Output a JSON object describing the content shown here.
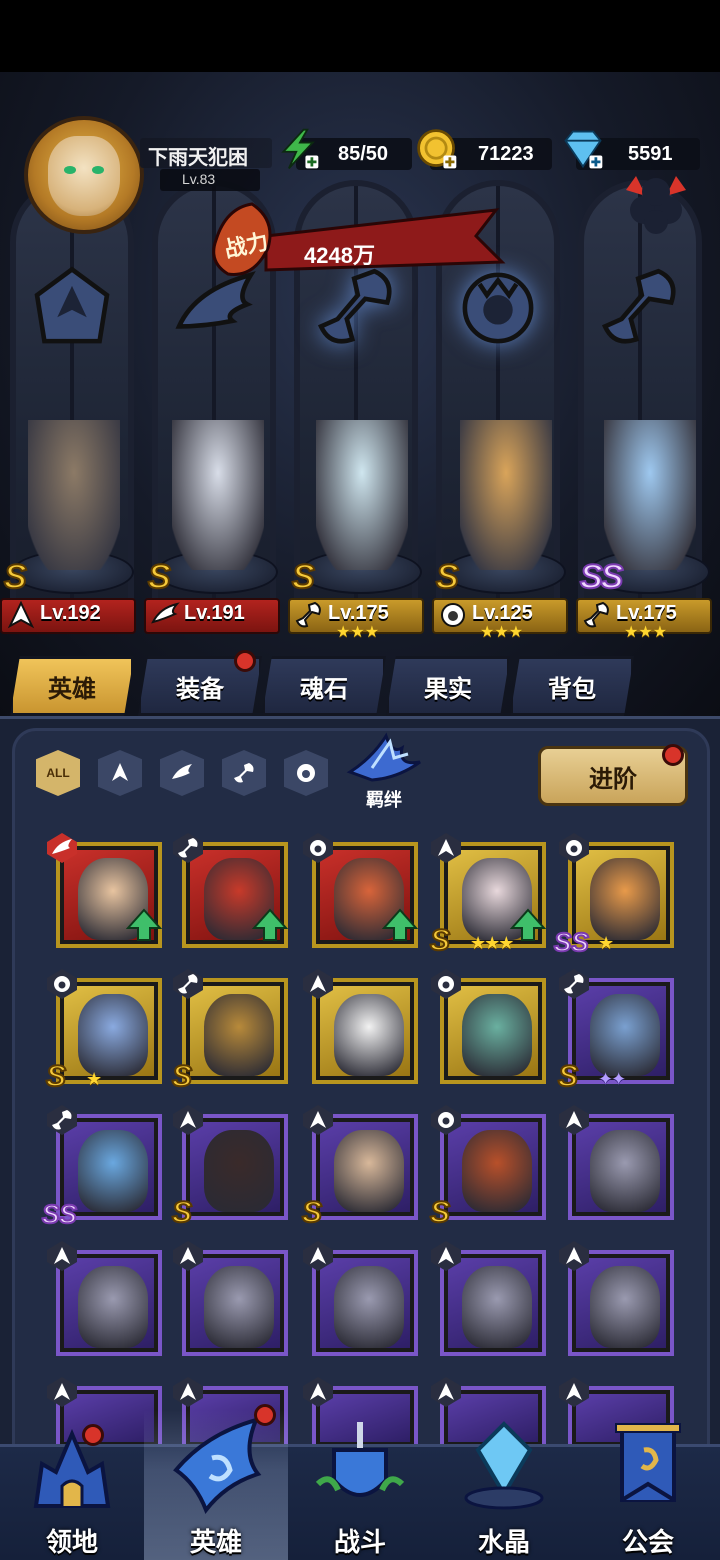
{
  "player": {
    "name": "下雨天犯困",
    "level": "Lv.83"
  },
  "resources": {
    "stamina": "85/50",
    "gold": "71223",
    "gems": "5591"
  },
  "power": {
    "label": "战力",
    "value": "4248万"
  },
  "team": [
    {
      "level": "Lv.192",
      "rank": "S",
      "class": "warrior",
      "stars": "",
      "plate": "red"
    },
    {
      "level": "Lv.191",
      "rank": "S",
      "class": "ranger",
      "stars": "",
      "plate": "red"
    },
    {
      "level": "Lv.175",
      "rank": "S",
      "class": "mechanic",
      "stars": "★★★",
      "plate": "gold"
    },
    {
      "level": "Lv.125",
      "rank": "S",
      "class": "beast",
      "stars": "★★★",
      "plate": "gold"
    },
    {
      "level": "Lv.175",
      "rank": "SS",
      "class": "mechanic",
      "stars": "★★★",
      "plate": "gold"
    }
  ],
  "tabs": [
    "英雄",
    "装备",
    "魂石",
    "果实",
    "背包"
  ],
  "filters": {
    "all_label": "ALL"
  },
  "bond_label": "羁绊",
  "advance_label": "进阶",
  "nav": [
    "领地",
    "英雄",
    "战斗",
    "水晶",
    "公会"
  ],
  "colors": {
    "gold": "#f5c93a",
    "red_plate": "#b2231e",
    "panel": "#222c45",
    "notify": "#d8342a"
  }
}
